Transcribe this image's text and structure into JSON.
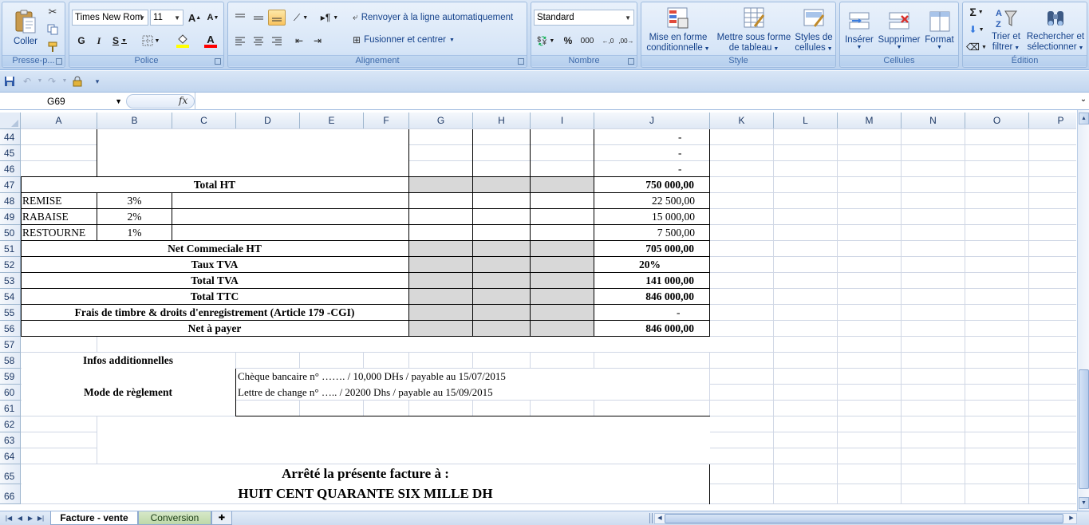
{
  "ribbon": {
    "clipboard": {
      "paste_label": "Coller",
      "group_label": "Presse-p..."
    },
    "font": {
      "family_value": "Times New Rom",
      "size_value": "11",
      "bold": "G",
      "italic": "I",
      "underline": "S",
      "font_color_glyph": "A",
      "grow": "A",
      "shrink": "A",
      "group_label": "Police",
      "fill_color": "#ffff00",
      "text_color": "#ff0000"
    },
    "alignment": {
      "wrap_label": "Renvoyer à la ligne automatiquement",
      "merge_label": "Fusionner et centrer",
      "group_label": "Alignement"
    },
    "number": {
      "format_value": "Standard",
      "percent": "%",
      "thousands": "000",
      "group_label": "Nombre"
    },
    "style": {
      "conditional_label_1": "Mise en forme",
      "conditional_label_2": "conditionnelle",
      "table_label_1": "Mettre sous forme",
      "table_label_2": "de tableau",
      "cell_styles_1": "Styles de",
      "cell_styles_2": "cellules",
      "group_label": "Style"
    },
    "cells": {
      "insert_label": "Insérer",
      "delete_label": "Supprimer",
      "format_label": "Format",
      "group_label": "Cellules"
    },
    "editing": {
      "sigma": "Σ",
      "sort_label_1": "Trier et",
      "sort_label_2": "filtrer",
      "find_label_1": "Rechercher et",
      "find_label_2": "sélectionner",
      "group_label": "Édition"
    }
  },
  "formula_bar": {
    "cell_ref": "G69",
    "fx": "fx",
    "value": ""
  },
  "columns": [
    "A",
    "B",
    "C",
    "D",
    "E",
    "F",
    "G",
    "H",
    "I",
    "J",
    "K",
    "L",
    "M",
    "N",
    "O",
    "P"
  ],
  "rows": [
    "44",
    "45",
    "46",
    "47",
    "48",
    "49",
    "50",
    "51",
    "52",
    "53",
    "54",
    "55",
    "56",
    "57",
    "58",
    "59",
    "60",
    "61",
    "62",
    "63",
    "64",
    "65",
    "66"
  ],
  "invoice": {
    "dash_44": "-",
    "dash_45": "-",
    "dash_46": "-",
    "total_ht_label": "Total HT",
    "total_ht_value": "750 000,00",
    "remise_label": "REMISE",
    "remise_rate": "3%",
    "remise_value": "22 500,00",
    "rabaise_label": "RABAISE",
    "rabaise_rate": "2%",
    "rabaise_value": "15 000,00",
    "restourne_label": "RESTOURNE",
    "restourne_rate": "1%",
    "restourne_value": "7 500,00",
    "net_commercial_label": "Net Commeciale HT",
    "net_commercial_value": "705 000,00",
    "taux_tva_label": "Taux TVA",
    "taux_tva_value": "20%",
    "total_tva_label": "Total TVA",
    "total_tva_value": "141 000,00",
    "total_ttc_label": "Total TTC",
    "total_ttc_value": "846 000,00",
    "frais_label": "Frais de timbre & droits d'enregistrement (Article 179 -CGI)",
    "frais_value": "-",
    "net_payer_label": "Net à payer",
    "net_payer_value": "846 000,00",
    "infos_label": "Infos additionnelles",
    "mode_label": "Mode de règlement",
    "cheque_text": "Chèque bancaire n°  ……. / 10,000 DHs / payable au 15/07/2015",
    "lettre_text": "Lettre de change n° ….. / 20200 Dhs / payable au 15/09/2015",
    "arrete_label": "Arrêté la présente facture à :",
    "amount_words": "HUIT CENT QUARANTE SIX MILLE DH"
  },
  "sheets": {
    "active": "Facture - vente",
    "other": "Conversion"
  }
}
